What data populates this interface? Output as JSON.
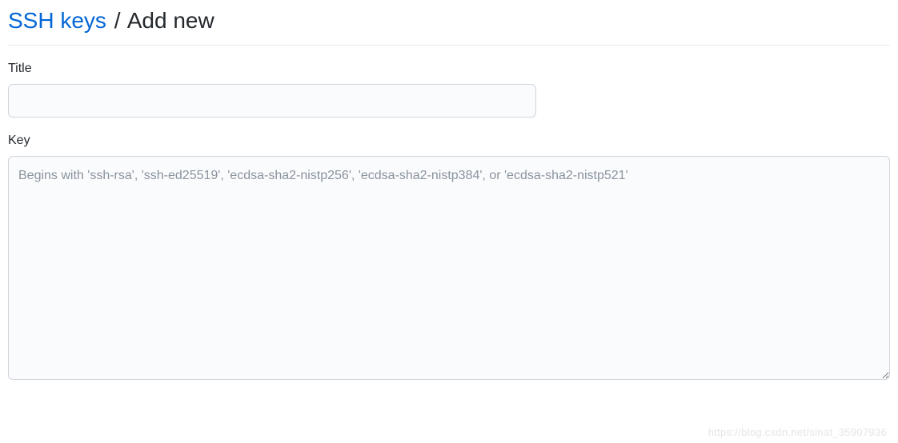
{
  "breadcrumb": {
    "link_label": "SSH keys",
    "separator": "/",
    "current": "Add new"
  },
  "form": {
    "title": {
      "label": "Title",
      "value": ""
    },
    "key": {
      "label": "Key",
      "placeholder": "Begins with 'ssh-rsa', 'ssh-ed25519', 'ecdsa-sha2-nistp256', 'ecdsa-sha2-nistp384', or 'ecdsa-sha2-nistp521'",
      "value": ""
    }
  },
  "watermark": "https://blog.csdn.net/sinat_35907936"
}
